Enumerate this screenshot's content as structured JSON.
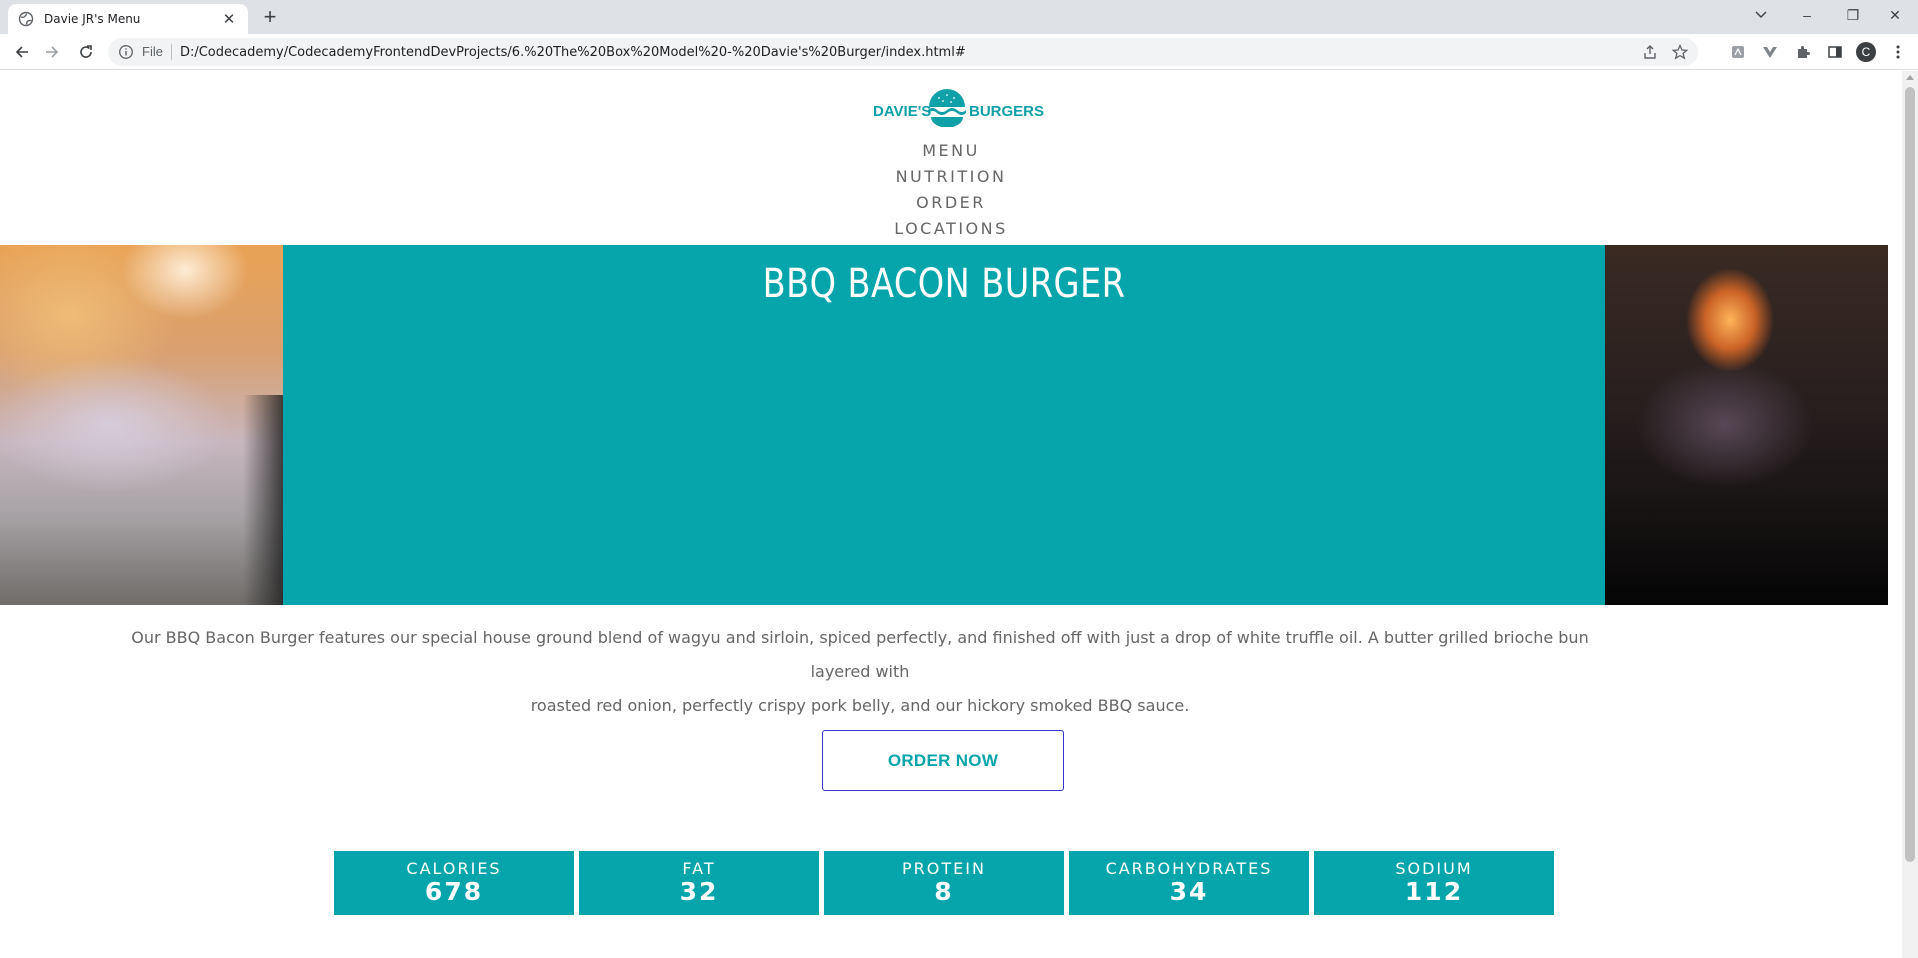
{
  "browser": {
    "tab_title": "Davie JR's Menu",
    "tab_close_glyph": "✕",
    "new_tab_glyph": "+",
    "address_scheme": "File",
    "address_url": "D:/Codecademy/CodecademyFrontendDevProjects/6.%20The%20Box%20Model%20-%20Davie's%20Burger/index.html#",
    "profile_initial": "C",
    "window_controls": {
      "minimize": "–",
      "restore": "❐",
      "close": "✕"
    },
    "icons": [
      "back-icon",
      "forward-icon",
      "reload-icon",
      "info-icon",
      "share-icon",
      "star-icon",
      "extension-icons",
      "puzzle-icon",
      "side-panel-icon",
      "menu-icon"
    ]
  },
  "site": {
    "logo": {
      "left": "DAVIE'S",
      "right": "BURGERS",
      "color": "#10a0a7"
    },
    "nav": [
      "MENU",
      "NUTRITION",
      "ORDER",
      "LOCATIONS"
    ]
  },
  "hero": {
    "title": "BBQ BACON BURGER",
    "accent": "#05a5ab"
  },
  "description": {
    "line1": "Our BBQ Bacon Burger features our special house ground blend of wagyu and sirloin, spiced perfectly, and finished off with just a drop of white truffle oil. A butter grilled brioche bun layered with",
    "line2": "roasted red onion, perfectly crispy pork belly, and our hickory smoked BBQ sauce."
  },
  "order_button": {
    "label": "ORDER NOW"
  },
  "nutrition": [
    {
      "label": "CALORIES",
      "value": "678"
    },
    {
      "label": "FAT",
      "value": "32"
    },
    {
      "label": "PROTEIN",
      "value": "8"
    },
    {
      "label": "CARBOHYDRATES",
      "value": "34"
    },
    {
      "label": "SODIUM",
      "value": "112"
    }
  ]
}
